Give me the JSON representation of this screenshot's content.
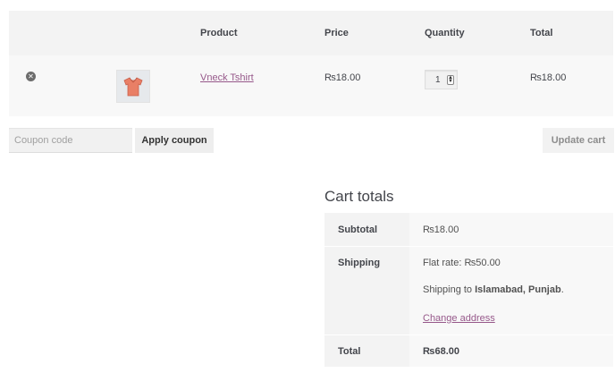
{
  "cart": {
    "headers": {
      "product": "Product",
      "price": "Price",
      "quantity": "Quantity",
      "total": "Total"
    },
    "item": {
      "name": "Vneck Tshirt",
      "price": "₨18.00",
      "quantity": "1",
      "total": "₨18.00"
    },
    "coupon_placeholder": "Coupon code",
    "apply_label": "Apply coupon",
    "update_label": "Update cart"
  },
  "totals": {
    "title": "Cart totals",
    "subtotal_label": "Subtotal",
    "subtotal_value": "₨18.00",
    "shipping_label": "Shipping",
    "flat_rate_label": "Flat rate:",
    "flat_rate_value": "₨50.00",
    "shipping_to_prefix": "Shipping to",
    "shipping_to_location": "Islamabad, Punjab",
    "shipping_to_suffix": ".",
    "change_address": "Change address",
    "total_label": "Total",
    "total_value": "₨68.00"
  },
  "colors": {
    "link": "#96588a",
    "product_image": "#e97f66"
  },
  "icons": {
    "remove": "remove-circle-x-icon",
    "product": "tshirt-icon",
    "spinner": "up-down-spinner-icon"
  }
}
